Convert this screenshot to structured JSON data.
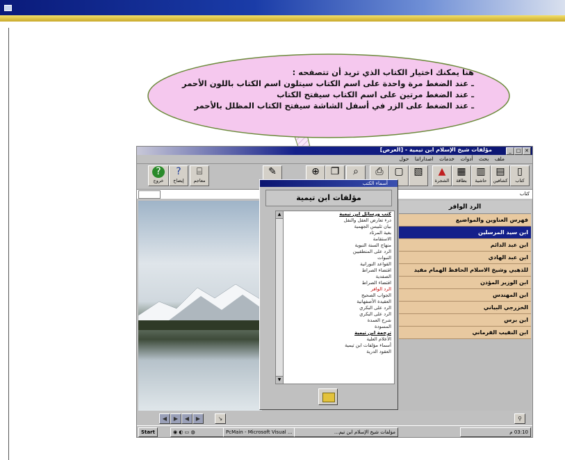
{
  "bubble": {
    "lines": [
      "هنا يمكنك اختيار الكتاب الذي تريد أن تتصفحه :",
      "ـ عند الضغط مرة واحدة على اسم الكتاب سيتلون اسم الكتاب باللون الأحمر",
      "ـ عند الضغط مرتين على اسم الكتاب سيفتح الكتاب",
      "ـ عند الضغط على الزر في أسفل الشاشة سيفتح الكتاب المظلل بالأحمر"
    ]
  },
  "app": {
    "title": "مؤلفات شيخ الإسلام ابن تيمية - [العرض]",
    "menu": [
      "ملف",
      "بحث",
      "أدوات",
      "خدمات",
      "اصداراتنا",
      "حول"
    ],
    "toolbar": {
      "book": "كتاب",
      "index": "كشافين",
      "margin": "حاشية",
      "card": "بطاقة",
      "tree": "الشجرة",
      "dict": "معاجم",
      "explain": "إيضاح",
      "exit": "خروج"
    },
    "addr_label": "كتاب",
    "list_head": "الرد الوافر",
    "list": [
      "فهرس العناوين والمواضيع",
      "ابن سيد المرسلين",
      "ابن عبد الدائم",
      "ابن عبد الهادي",
      "للذهبي وشيخ الاسلام الحافظ الهمام مفيد",
      "ابن الوزير المؤذن",
      "ابن المهندس",
      "الخزرجي البياني",
      "ابن برس",
      "ابن النقيب القرماني"
    ],
    "selected_index": 1,
    "taskbar": {
      "start": "Start",
      "task1": "PcMain - Microsoft Visual ...",
      "task2": "مؤلفات شيخ الإسلام ابن تيم...",
      "clock": "03:10 م"
    }
  },
  "dialog": {
    "title": "أسماء الكتب",
    "header": "مؤلفات ابن تيمية",
    "items": [
      {
        "text": "كتب ورسائل ابن تيمية",
        "style": "hd"
      },
      {
        "text": "درء تعارض العقل والنقل",
        "style": ""
      },
      {
        "text": "بيان تلبيس الجهمية",
        "style": ""
      },
      {
        "text": "بغية المرتاد",
        "style": ""
      },
      {
        "text": "الاستقامة",
        "style": ""
      },
      {
        "text": "منهاج السنة النبوية",
        "style": ""
      },
      {
        "text": "الرد على المنطقيين",
        "style": ""
      },
      {
        "text": "النبوات",
        "style": ""
      },
      {
        "text": "القواعد النورانية",
        "style": ""
      },
      {
        "text": "اقتضاء الصراط",
        "style": ""
      },
      {
        "text": "الصفدية",
        "style": ""
      },
      {
        "text": "اقتضاء الصراط",
        "style": ""
      },
      {
        "text": "الرد الوافر",
        "style": "red"
      },
      {
        "text": "الجواب الصحيح",
        "style": ""
      },
      {
        "text": "العقيدة الأصفهانية",
        "style": ""
      },
      {
        "text": "الرد على البكري",
        "style": ""
      },
      {
        "text": "الرد على البكري",
        "style": ""
      },
      {
        "text": "شرح العمدة",
        "style": ""
      },
      {
        "text": "المسودة",
        "style": ""
      },
      {
        "text": "ترجمة ابن تيمية",
        "style": "hd"
      },
      {
        "text": "الأعلام العلية",
        "style": ""
      },
      {
        "text": "أسماء مؤلفات ابن تيمية",
        "style": ""
      },
      {
        "text": "العقود الدرية",
        "style": ""
      }
    ]
  }
}
